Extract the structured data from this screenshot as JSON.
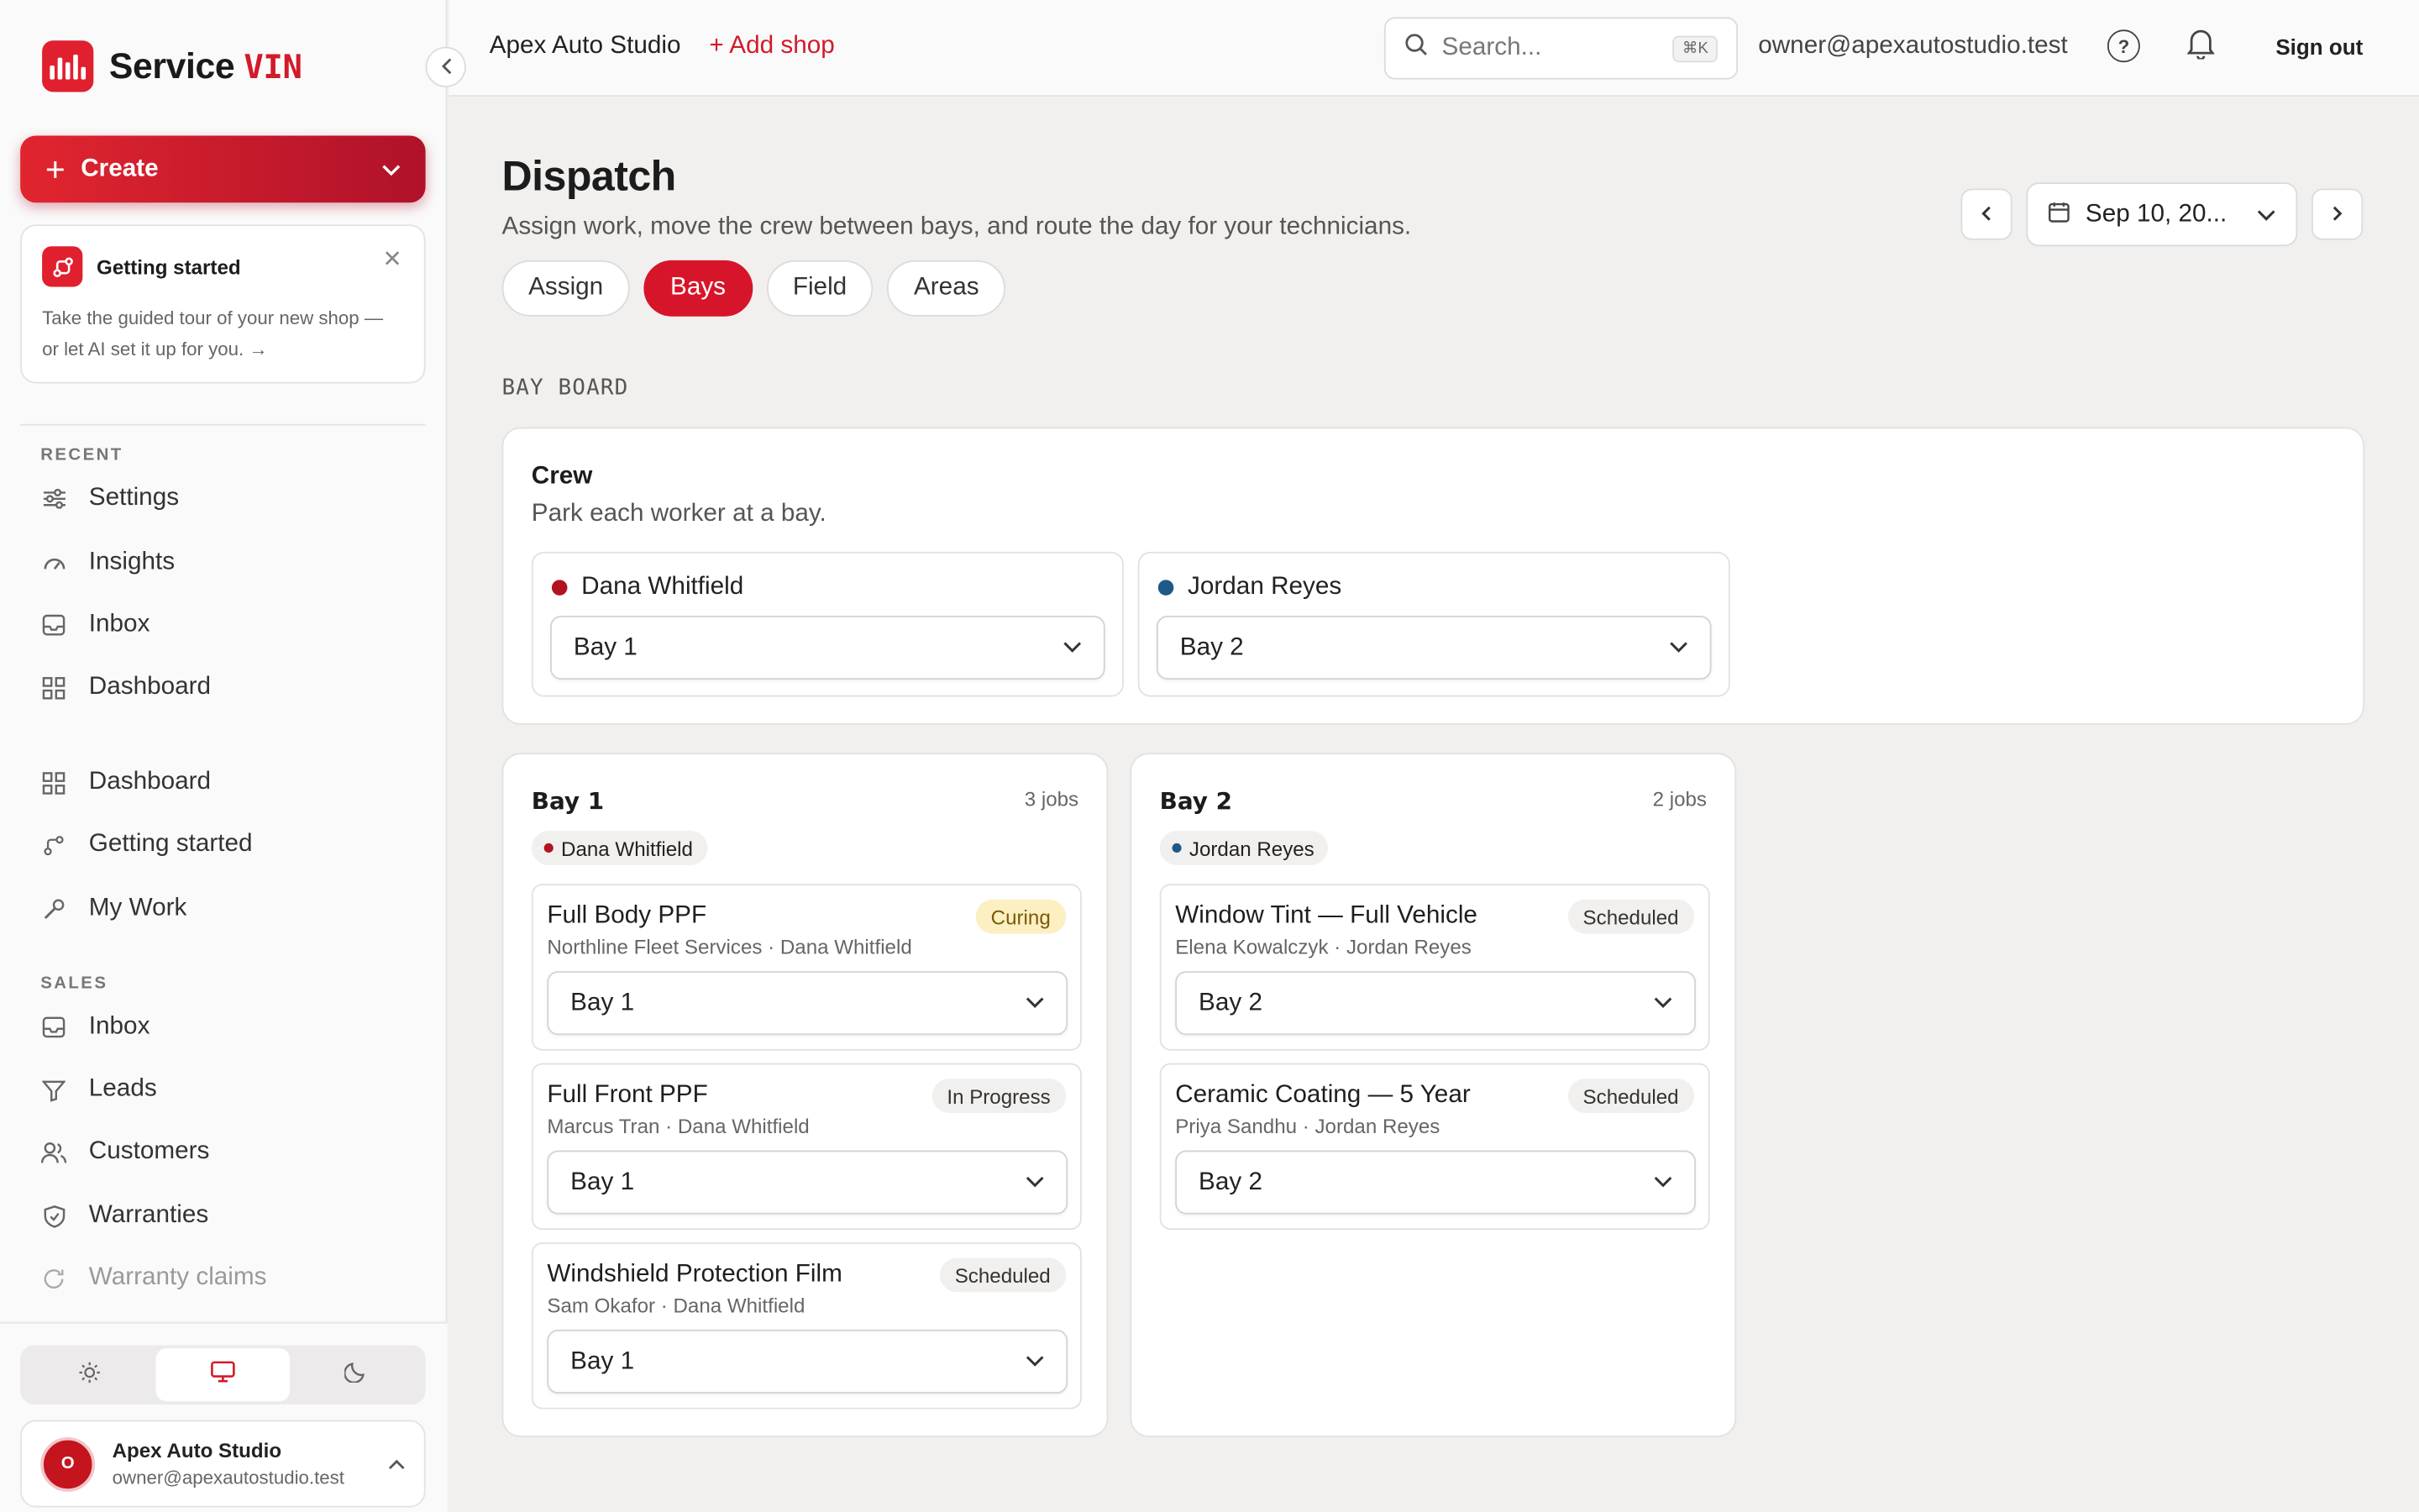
{
  "sidebar": {
    "brand": "Service",
    "brand_suffix": "VIN",
    "create_label": "Create",
    "getting_started": {
      "title": "Getting started",
      "description": "Take the guided tour of your new shop — or let AI set it up for you. →"
    },
    "recent_label": "RECENT",
    "recent_items": [
      {
        "label": "Settings",
        "icon": "sliders-icon"
      },
      {
        "label": "Insights",
        "icon": "gauge-icon"
      },
      {
        "label": "Inbox",
        "icon": "inbox-icon"
      },
      {
        "label": "Dashboard",
        "icon": "grid-icon"
      }
    ],
    "main_items": [
      {
        "label": "Dashboard",
        "icon": "grid-icon"
      },
      {
        "label": "Getting started",
        "icon": "route-icon"
      },
      {
        "label": "My Work",
        "icon": "wrench-icon"
      }
    ],
    "sales_label": "SALES",
    "sales_items": [
      {
        "label": "Inbox",
        "icon": "inbox-icon"
      },
      {
        "label": "Leads",
        "icon": "filter-icon"
      },
      {
        "label": "Customers",
        "icon": "users-icon"
      },
      {
        "label": "Warranties",
        "icon": "shield-icon"
      },
      {
        "label": "Warranty claims",
        "icon": "refresh-icon"
      }
    ],
    "theme_options": [
      "light",
      "system",
      "dark"
    ],
    "theme_selected": "system",
    "account": {
      "initial": "O",
      "name": "Apex Auto Studio",
      "email": "owner@apexautostudio.test"
    }
  },
  "topbar": {
    "shop_name": "Apex Auto Studio",
    "add_shop": "+ Add shop",
    "search_placeholder": "Search...",
    "search_shortcut": "⌘K",
    "user_email": "owner@apexautostudio.test",
    "sign_out": "Sign out"
  },
  "main": {
    "title": "Dispatch",
    "subtitle": "Assign work, move the crew between bays, and route the day for your technicians.",
    "tabs": [
      {
        "label": "Assign",
        "active": false
      },
      {
        "label": "Bays",
        "active": true
      },
      {
        "label": "Field",
        "active": false
      },
      {
        "label": "Areas",
        "active": false
      }
    ],
    "date": "Sep 10, 20...",
    "board_label": "BAY BOARD",
    "crew": {
      "title": "Crew",
      "subtitle": "Park each worker at a bay.",
      "workers": [
        {
          "name": "Dana Whitfield",
          "color": "#b3121f",
          "bay": "Bay 1"
        },
        {
          "name": "Jordan Reyes",
          "color": "#1d5a87",
          "bay": "Bay 2"
        }
      ]
    },
    "bays": [
      {
        "name": "Bay 1",
        "jobs_count": "3 jobs",
        "worker": "Dana Whitfield",
        "worker_color": "#b3121f",
        "jobs": [
          {
            "title": "Full Body PPF",
            "meta": "Northline Fleet Services · Dana Whitfield",
            "status": "Curing",
            "bay": "Bay 1"
          },
          {
            "title": "Full Front PPF",
            "meta": "Marcus Tran · Dana Whitfield",
            "status": "In Progress",
            "bay": "Bay 1"
          },
          {
            "title": "Windshield Protection Film",
            "meta": "Sam Okafor · Dana Whitfield",
            "status": "Scheduled",
            "bay": "Bay 1"
          }
        ]
      },
      {
        "name": "Bay 2",
        "jobs_count": "2 jobs",
        "worker": "Jordan Reyes",
        "worker_color": "#1d5a87",
        "jobs": [
          {
            "title": "Window Tint — Full Vehicle",
            "meta": "Elena Kowalczyk · Jordan Reyes",
            "status": "Scheduled",
            "bay": "Bay 2"
          },
          {
            "title": "Ceramic Coating — 5 Year",
            "meta": "Priya Sandhu · Jordan Reyes",
            "status": "Scheduled",
            "bay": "Bay 2"
          }
        ]
      }
    ]
  },
  "colors": {
    "accent": "#d7152a",
    "background": "#f1f0ee",
    "curing_badge": "#fcefc2"
  }
}
